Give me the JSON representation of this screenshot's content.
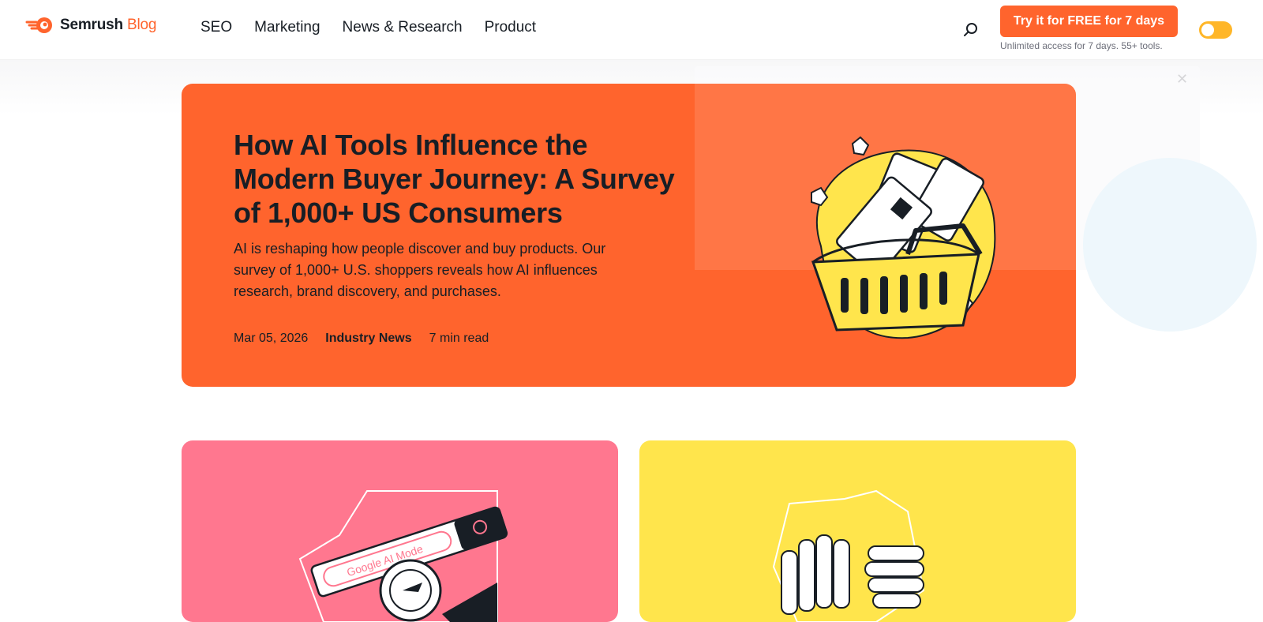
{
  "header": {
    "logo_name": "Semrush",
    "logo_accent": "Blog",
    "nav": [
      "SEO",
      "Marketing",
      "News & Research",
      "Product"
    ],
    "cta_label": "Try it for FREE for 7 days",
    "cta_sub": "Unlimited access for 7 days. 55+ tools.",
    "search_icon": "search-icon",
    "theme_toggle_icon": "theme-toggle-icon"
  },
  "hero": {
    "title": "How AI Tools Influence the Modern Buyer Journey: A Survey of 1,000+ US Consumers",
    "description": "AI is reshaping how people discover and buy products. Our survey of 1,000+ U.S. shoppers reveals how AI influences research, brand discovery, and purchases.",
    "date": "Mar 05, 2026",
    "category": "Industry News",
    "read_time": "7 min read",
    "illustration": "shopping-basket-illustration"
  },
  "cards": [
    {
      "illustration": "google-ai-mode-illustration",
      "image_text": "Google AI Mode",
      "color": "#ff778f"
    },
    {
      "illustration": "robot-hands-illustration",
      "color": "#ffe54c"
    }
  ],
  "colors": {
    "brand_orange": "#ff642d",
    "toggle": "#ffb628",
    "text": "#181e25"
  }
}
